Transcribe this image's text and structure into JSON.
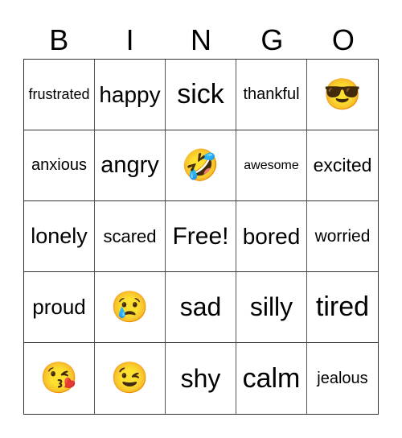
{
  "header": [
    "B",
    "I",
    "N",
    "G",
    "O"
  ],
  "cells": [
    {
      "text": "frustrated",
      "type": "text",
      "size": 18
    },
    {
      "text": "happy",
      "type": "text",
      "size": 28
    },
    {
      "text": "sick",
      "type": "text",
      "size": 34
    },
    {
      "text": "thankful",
      "type": "text",
      "size": 20
    },
    {
      "text": "😎",
      "type": "emoji",
      "name": "smiling-face-with-sunglasses-icon"
    },
    {
      "text": "anxious",
      "type": "text",
      "size": 20
    },
    {
      "text": "angry",
      "type": "text",
      "size": 29
    },
    {
      "text": "🤣",
      "type": "emoji",
      "name": "rolling-on-the-floor-laughing-icon"
    },
    {
      "text": "awesome",
      "type": "text",
      "size": 16
    },
    {
      "text": "excited",
      "type": "text",
      "size": 23
    },
    {
      "text": "lonely",
      "type": "text",
      "size": 27
    },
    {
      "text": "scared",
      "type": "text",
      "size": 22
    },
    {
      "text": "Free!",
      "type": "text",
      "size": 30
    },
    {
      "text": "bored",
      "type": "text",
      "size": 28
    },
    {
      "text": "worried",
      "type": "text",
      "size": 21
    },
    {
      "text": "proud",
      "type": "text",
      "size": 26
    },
    {
      "text": "😢",
      "type": "emoji",
      "name": "crying-face-icon"
    },
    {
      "text": "sad",
      "type": "text",
      "size": 32
    },
    {
      "text": "silly",
      "type": "text",
      "size": 32
    },
    {
      "text": "tired",
      "type": "text",
      "size": 34
    },
    {
      "text": "😘",
      "type": "emoji",
      "name": "face-blowing-a-kiss-icon"
    },
    {
      "text": "😉",
      "type": "emoji",
      "name": "winking-face-icon"
    },
    {
      "text": "shy",
      "type": "text",
      "size": 32
    },
    {
      "text": "calm",
      "type": "text",
      "size": 34
    },
    {
      "text": "jealous",
      "type": "text",
      "size": 20
    }
  ]
}
